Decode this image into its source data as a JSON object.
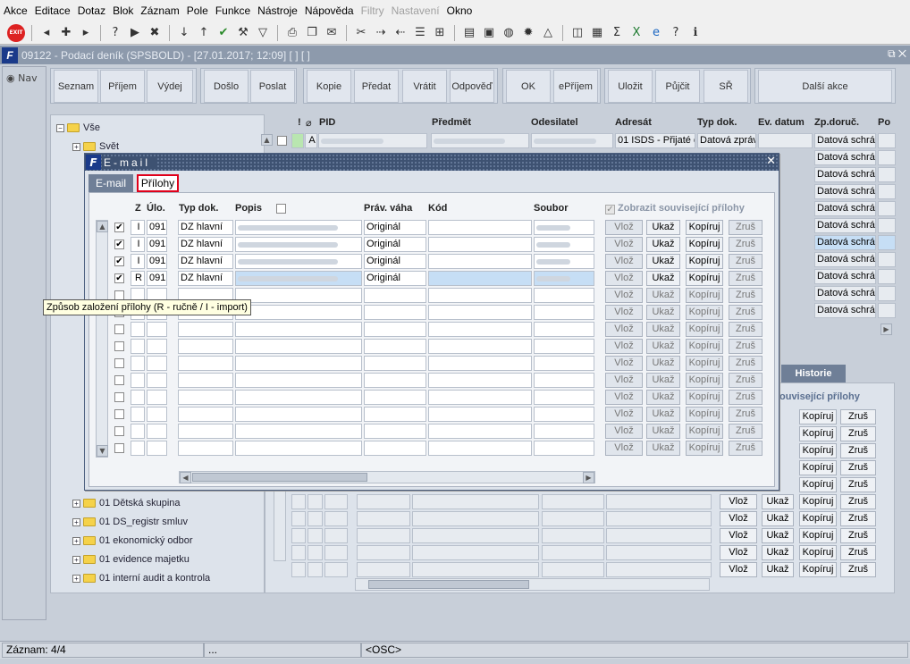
{
  "menu": [
    "Akce",
    "Editace",
    "Dotaz",
    "Blok",
    "Záznam",
    "Pole",
    "Funkce",
    "Nástroje",
    "Nápověda",
    "Filtry",
    "Nastavení",
    "Okno"
  ],
  "menu_disabled": [
    "Filtry",
    "Nastavení"
  ],
  "toolbar": {
    "exit_label": "EXIT"
  },
  "window": {
    "title": "09122 - Podací deník (SPSBOLD) - [27.01.2017; 12:09]  [ ]  [ ]"
  },
  "nav": {
    "label": "Nav"
  },
  "buttons": [
    "Seznam",
    "Příjem",
    "Výdej",
    "Došlo",
    "Poslat",
    "Kopie",
    "Předat",
    "Vrátit",
    "Odpověď",
    "OK",
    "ePříjem",
    "Uložit",
    "Půjčit",
    "SŘ",
    "Další akce"
  ],
  "tree": {
    "root": "Vše",
    "items": [
      "Svět",
      "01 Dětská skupina",
      "01 DS_registr smluv",
      "01 ekonomický odbor",
      "01 evidence majetku",
      "01 interní audit a kontrola"
    ]
  },
  "grid": {
    "headers": [
      "!",
      "PID",
      "Předmět",
      "Odesilatel",
      "Adresát",
      "Typ dok.",
      "Ev. datum",
      "Zp.doruč.",
      "Po"
    ],
    "first_row": {
      "flag": "A",
      "adresat": "01 ISDS - Přijaté d",
      "typ": "Datová zpráv",
      "zpdoruc": "Datová schrá"
    },
    "zpdoruc_values": [
      "Datová schrá",
      "Datová schrá",
      "Datová schrá",
      "Datová schrá",
      "Datová schrá",
      "Datová schrá",
      "Datová schrá",
      "Datová schrá",
      "Datová schrá",
      "Datová schrá"
    ]
  },
  "dialog": {
    "title": "E-mail",
    "tabs": [
      "E-mail",
      "Přílohy"
    ],
    "active_tab": "Přílohy",
    "headers": {
      "z": "Z",
      "ulo": "Úlo.",
      "typ": "Typ dok.",
      "popis": "Popis",
      "prav": "Práv. váha",
      "kod": "Kód",
      "soubor": "Soubor"
    },
    "show_related_label": "Zobrazit související přílohy",
    "rows": [
      {
        "checked": true,
        "z": "I",
        "ulo": "091",
        "typ": "DZ hlavní",
        "prav": "Originál"
      },
      {
        "checked": true,
        "z": "I",
        "ulo": "091",
        "typ": "DZ hlavní",
        "prav": "Originál"
      },
      {
        "checked": true,
        "z": "I",
        "ulo": "091",
        "typ": "DZ hlavní",
        "prav": "Originál"
      },
      {
        "checked": true,
        "z": "R",
        "ulo": "091",
        "typ": "DZ hlavní",
        "prav": "Originál"
      }
    ],
    "action_buttons": {
      "vloz": "Vlož",
      "ukaz": "Ukaž",
      "kopiruj": "Kopíruj",
      "zrus": "Zruš"
    }
  },
  "tooltip": "Způsob založení přílohy (R - ručně / I - import)",
  "history_tab": "Historie",
  "lower_related_label": "ouvisející přílohy",
  "status": {
    "record": "Záznam: 4/4",
    "ellipsis": "...",
    "osc": "<OSC>"
  }
}
